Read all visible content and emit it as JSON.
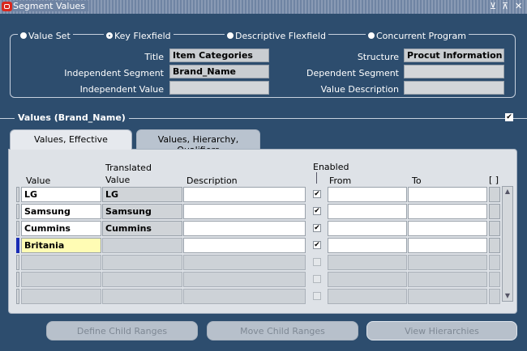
{
  "window": {
    "title": "Segment Values",
    "controls": [
      "⊻",
      "⊼",
      "✕"
    ]
  },
  "radios": [
    {
      "label": "Value Set",
      "selected": false
    },
    {
      "label": "Key Flexfield",
      "selected": true
    },
    {
      "label": "Descriptive Flexfield",
      "selected": false
    },
    {
      "label": "Concurrent Program",
      "selected": false
    }
  ],
  "fields": {
    "title_label": "Title",
    "title_value": "Item Categories",
    "structure_label": "Structure",
    "structure_value": "Procut Information",
    "indep_seg_label": "Independent Segment",
    "indep_seg_value": "Brand_Name",
    "dep_seg_label": "Dependent Segment",
    "dep_seg_value": "",
    "indep_val_label": "Independent Value",
    "indep_val_value": "",
    "val_desc_label": "Value Description",
    "val_desc_value": ""
  },
  "section": {
    "title": "Values (Brand_Name)",
    "checked": true
  },
  "tabs": [
    {
      "label": "Values, Effective",
      "active": true
    },
    {
      "label": "Values, Hierarchy, Qualifiers",
      "active": false
    }
  ],
  "columns": {
    "value": "Value",
    "translated_top": "Translated",
    "translated_bottom": "Value",
    "description": "Description",
    "enabled": "Enabled",
    "from": "From",
    "to": "To",
    "flex": "[ ]"
  },
  "rows": [
    {
      "value": "LG",
      "translated": "LG",
      "description": "",
      "enabled": true,
      "from": "",
      "to": ""
    },
    {
      "value": "Samsung",
      "translated": "Samsung",
      "description": "",
      "enabled": true,
      "from": "",
      "to": ""
    },
    {
      "value": "Cummins",
      "translated": "Cummins",
      "description": "",
      "enabled": true,
      "from": "",
      "to": ""
    },
    {
      "value": "Britania",
      "translated": "",
      "description": "",
      "enabled": true,
      "from": "",
      "to": ""
    },
    {
      "value": "",
      "translated": "",
      "description": "",
      "enabled": false,
      "from": "",
      "to": ""
    },
    {
      "value": "",
      "translated": "",
      "description": "",
      "enabled": false,
      "from": "",
      "to": ""
    },
    {
      "value": "",
      "translated": "",
      "description": "",
      "enabled": false,
      "from": "",
      "to": ""
    }
  ],
  "buttons": {
    "define_child": "Define Child Ranges",
    "move_child": "Move Child Ranges",
    "view_hier": "View Hierarchies"
  },
  "colors": {
    "background": "#2d4d6e",
    "panel": "#dee2e7",
    "current_cell": "#fffcb4",
    "row_marker": "#1a2cb4",
    "title_icon": "#d8281e"
  }
}
